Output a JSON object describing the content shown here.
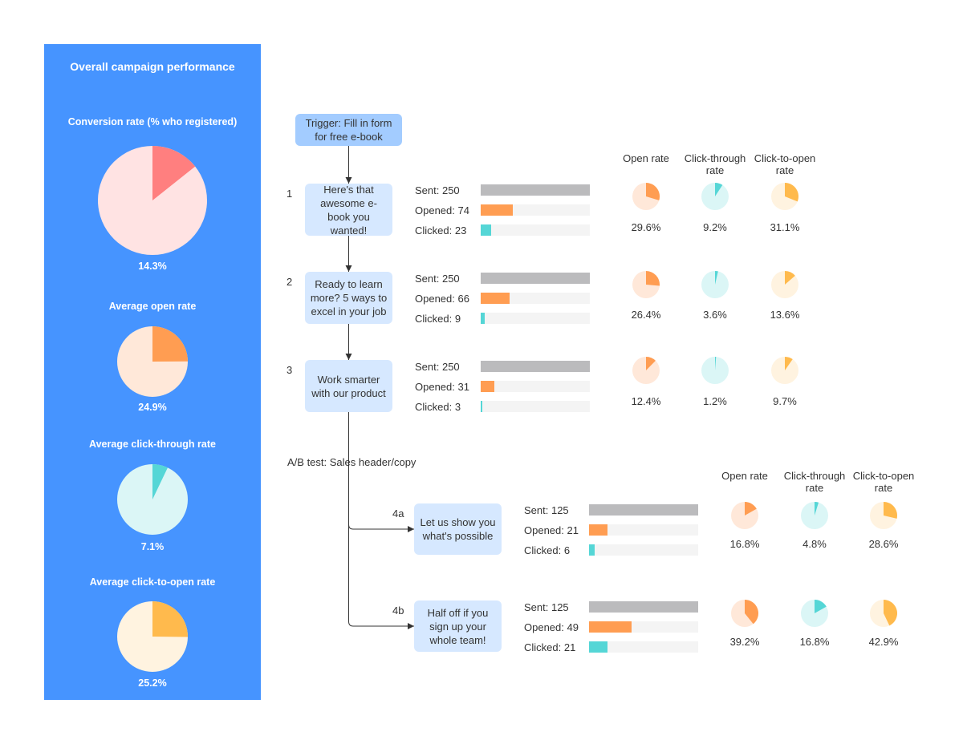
{
  "colors": {
    "panel": "#4694FF",
    "conversion": "#FF7F7F",
    "conversion_bg": "#FFE3E3",
    "open": "#FF9D52",
    "open_bg": "#FFE8D9",
    "ctr": "#55D6D6",
    "ctr_bg": "#DBF6F6",
    "cto": "#FFBA4D",
    "cto_bg": "#FFF3E0",
    "sent": "#BBBBBD",
    "track": "#F4F4F4",
    "trigger": "#A3CCFF",
    "email": "#D6E8FF"
  },
  "overall": {
    "title": "Overall campaign performance",
    "metrics": [
      {
        "label": "Conversion rate (% who registered)",
        "value": 14.3,
        "text": "14.3%",
        "color": "conversion"
      },
      {
        "label": "Average open rate",
        "value": 24.9,
        "text": "24.9%",
        "color": "open"
      },
      {
        "label": "Average click-through rate",
        "value": 7.1,
        "text": "7.1%",
        "color": "ctr"
      },
      {
        "label": "Average click-to-open rate",
        "value": 25.2,
        "text": "25.2%",
        "color": "cto"
      }
    ]
  },
  "trigger": "Trigger: Fill in form for free e-book",
  "headers": {
    "open": "Open rate",
    "ctr": "Click-through rate",
    "cto": "Click-to-open rate"
  },
  "ab_test_label": "A/B test: Sales header/copy",
  "emails": [
    {
      "num": "1",
      "title": "Here's that awesome e-book you wanted!",
      "sent": 250,
      "opened": 74,
      "clicked": 23,
      "sent_label": "Sent: 250",
      "opened_label": "Opened: 74",
      "clicked_label": "Clicked: 23",
      "open_rate": 29.6,
      "ctr": 9.2,
      "cto": 31.1,
      "open_text": "29.6%",
      "ctr_text": "9.2%",
      "cto_text": "31.1%"
    },
    {
      "num": "2",
      "title": "Ready to learn more? 5 ways to excel in your job",
      "sent": 250,
      "opened": 66,
      "clicked": 9,
      "sent_label": "Sent: 250",
      "opened_label": "Opened: 66",
      "clicked_label": "Clicked: 9",
      "open_rate": 26.4,
      "ctr": 3.6,
      "cto": 13.6,
      "open_text": "26.4%",
      "ctr_text": "3.6%",
      "cto_text": "13.6%"
    },
    {
      "num": "3",
      "title": "Work smarter with our product",
      "sent": 250,
      "opened": 31,
      "clicked": 3,
      "sent_label": "Sent: 250",
      "opened_label": "Opened: 31",
      "clicked_label": "Clicked: 3",
      "open_rate": 12.4,
      "ctr": 1.2,
      "cto": 9.7,
      "open_text": "12.4%",
      "ctr_text": "1.2%",
      "cto_text": "9.7%"
    },
    {
      "num": "4a",
      "title": "Let us show you what's possible",
      "sent": 125,
      "opened": 21,
      "clicked": 6,
      "sent_label": "Sent: 125",
      "opened_label": "Opened: 21",
      "clicked_label": "Clicked: 6",
      "open_rate": 16.8,
      "ctr": 4.8,
      "cto": 28.6,
      "open_text": "16.8%",
      "ctr_text": "4.8%",
      "cto_text": "28.6%"
    },
    {
      "num": "4b",
      "title": "Half off if you sign up your whole team!",
      "sent": 125,
      "opened": 49,
      "clicked": 21,
      "sent_label": "Sent: 125",
      "opened_label": "Opened: 49",
      "clicked_label": "Clicked: 21",
      "open_rate": 39.2,
      "ctr": 16.8,
      "cto": 42.9,
      "open_text": "39.2%",
      "ctr_text": "16.8%",
      "cto_text": "42.9%"
    }
  ]
}
